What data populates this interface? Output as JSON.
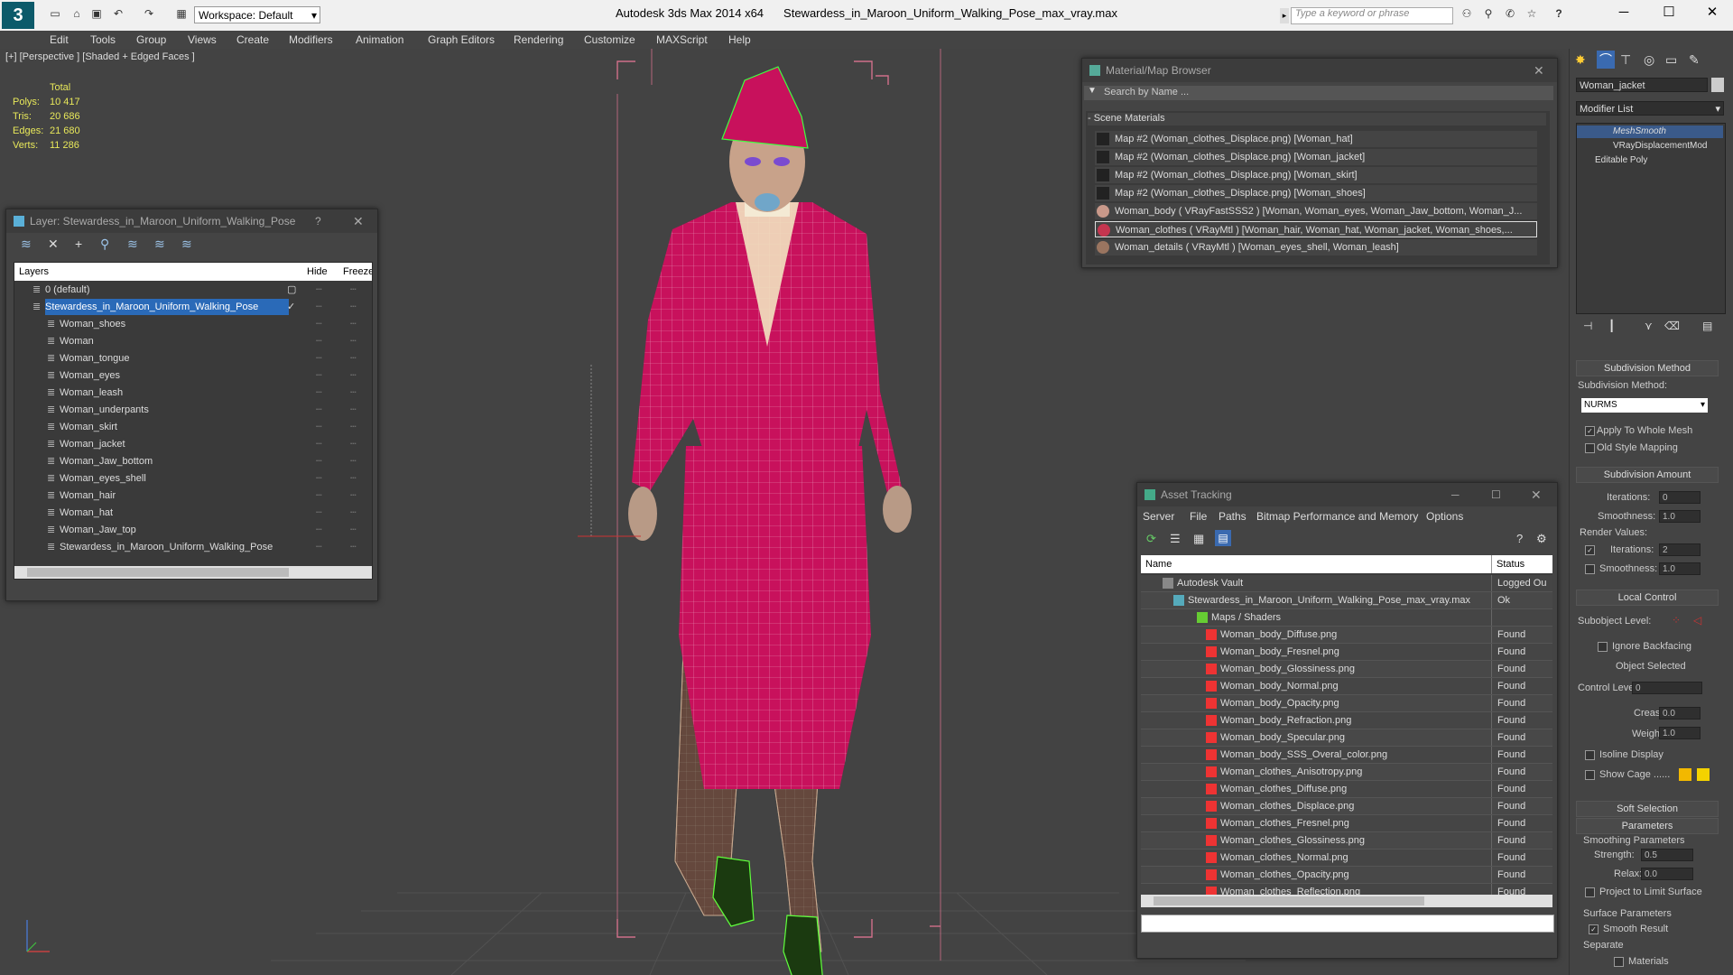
{
  "app": {
    "title": "Autodesk 3ds Max  2014 x64",
    "file": "Stewardess_in_Maroon_Uniform_Walking_Pose_max_vray.max",
    "workspace": "Workspace: Default",
    "search_placeholder": "Type a keyword or phrase"
  },
  "menu": [
    "Edit",
    "Tools",
    "Group",
    "Views",
    "Create",
    "Modifiers",
    "Animation",
    "Graph Editors",
    "Rendering",
    "Customize",
    "MAXScript",
    "Help"
  ],
  "viewport": {
    "label": "[+] [Perspective ] [Shaded + Edged Faces ]",
    "stats_header": "Total",
    "stats": [
      {
        "label": "Polys:",
        "value": "10 417"
      },
      {
        "label": "Tris:",
        "value": "20 686"
      },
      {
        "label": "Edges:",
        "value": "21 680"
      },
      {
        "label": "Verts:",
        "value": "11 286"
      }
    ]
  },
  "layer_panel": {
    "title": "Layer: Stewardess_in_Maroon_Uniform_Walking_Pose",
    "help": "?",
    "col_layers": "Layers",
    "col_hide": "Hide",
    "col_freeze": "Freeze",
    "layers": [
      {
        "name": "0 (default)",
        "level": 0
      },
      {
        "name": "Stewardess_in_Maroon_Uniform_Walking_Pose",
        "level": 0
      },
      {
        "name": "Woman_shoes",
        "level": 1
      },
      {
        "name": "Woman",
        "level": 1
      },
      {
        "name": "Woman_tongue",
        "level": 1
      },
      {
        "name": "Woman_eyes",
        "level": 1
      },
      {
        "name": "Woman_leash",
        "level": 1
      },
      {
        "name": "Woman_underpants",
        "level": 1
      },
      {
        "name": "Woman_skirt",
        "level": 1
      },
      {
        "name": "Woman_jacket",
        "level": 1
      },
      {
        "name": "Woman_Jaw_bottom",
        "level": 1
      },
      {
        "name": "Woman_eyes_shell",
        "level": 1
      },
      {
        "name": "Woman_hair",
        "level": 1
      },
      {
        "name": "Woman_hat",
        "level": 1
      },
      {
        "name": "Woman_Jaw_top",
        "level": 1
      },
      {
        "name": "Stewardess_in_Maroon_Uniform_Walking_Pose",
        "level": 1
      }
    ]
  },
  "material_browser": {
    "title": "Material/Map Browser",
    "search_placeholder": "Search by Name ...",
    "section": "- Scene Materials",
    "items": [
      "Map #2 (Woman_clothes_Displace.png)  [Woman_hat]",
      "Map #2 (Woman_clothes_Displace.png)  [Woman_jacket]",
      "Map #2 (Woman_clothes_Displace.png)  [Woman_skirt]",
      "Map #2 (Woman_clothes_Displace.png)  [Woman_shoes]",
      "Woman_body  ( VRayFastSSS2 )  [Woman, Woman_eyes, Woman_Jaw_bottom, Woman_J...",
      "Woman_clothes  ( VRayMtl )  [Woman_hair, Woman_hat, Woman_jacket, Woman_shoes,...",
      "Woman_details  ( VRayMtl )  [Woman_eyes_shell, Woman_leash]"
    ]
  },
  "asset_tracking": {
    "title": "Asset Tracking",
    "menu": [
      "Server",
      "File",
      "Paths",
      "Bitmap Performance and Memory",
      "Options"
    ],
    "col_name": "Name",
    "col_status": "Status",
    "rows": [
      {
        "name": "Autodesk Vault",
        "status": "Logged Ou",
        "indent": 0
      },
      {
        "name": "Stewardess_in_Maroon_Uniform_Walking_Pose_max_vray.max",
        "status": "Ok",
        "indent": 1
      },
      {
        "name": "Maps / Shaders",
        "status": "",
        "indent": 2
      },
      {
        "name": "Woman_body_Diffuse.png",
        "status": "Found",
        "indent": 3
      },
      {
        "name": "Woman_body_Fresnel.png",
        "status": "Found",
        "indent": 3
      },
      {
        "name": "Woman_body_Glossiness.png",
        "status": "Found",
        "indent": 3
      },
      {
        "name": "Woman_body_Normal.png",
        "status": "Found",
        "indent": 3
      },
      {
        "name": "Woman_body_Opacity.png",
        "status": "Found",
        "indent": 3
      },
      {
        "name": "Woman_body_Refraction.png",
        "status": "Found",
        "indent": 3
      },
      {
        "name": "Woman_body_Specular.png",
        "status": "Found",
        "indent": 3
      },
      {
        "name": "Woman_body_SSS_Overal_color.png",
        "status": "Found",
        "indent": 3
      },
      {
        "name": "Woman_clothes_Anisotropy.png",
        "status": "Found",
        "indent": 3
      },
      {
        "name": "Woman_clothes_Diffuse.png",
        "status": "Found",
        "indent": 3
      },
      {
        "name": "Woman_clothes_Displace.png",
        "status": "Found",
        "indent": 3
      },
      {
        "name": "Woman_clothes_Fresnel.png",
        "status": "Found",
        "indent": 3
      },
      {
        "name": "Woman_clothes_Glossiness.png",
        "status": "Found",
        "indent": 3
      },
      {
        "name": "Woman_clothes_Normal.png",
        "status": "Found",
        "indent": 3
      },
      {
        "name": "Woman_clothes_Opacity.png",
        "status": "Found",
        "indent": 3
      },
      {
        "name": "Woman_clothes_Reflection.png",
        "status": "Found",
        "indent": 3
      }
    ]
  },
  "command_panel": {
    "object_name": "Woman_jacket",
    "modifier_list": "Modifier List",
    "stack": [
      "MeshSmooth",
      "VRayDisplacementMod",
      "Editable Poly"
    ],
    "subdivision_method_header": "Subdivision Method",
    "subdivision_method_label": "Subdivision Method:",
    "subdivision_method_value": "NURMS",
    "apply_whole_mesh": "Apply To Whole Mesh",
    "old_style_mapping": "Old Style Mapping",
    "subdivision_amount_header": "Subdivision Amount",
    "iterations_label": "Iterations:",
    "iterations_value": "0",
    "smoothness_label": "Smoothness:",
    "smoothness_value": "1.0",
    "render_values_label": "Render Values:",
    "render_iterations_label": "Iterations:",
    "render_iterations_value": "2",
    "render_smoothness_label": "Smoothness:",
    "render_smoothness_value": "1.0",
    "local_control_header": "Local Control",
    "subobject_level_label": "Subobject Level:",
    "ignore_backfacing": "Ignore Backfacing",
    "object_selected": "Object Selected",
    "control_level_label": "Control Level:",
    "control_level_value": "0",
    "crease_label": "Crease:",
    "crease_value": "0.0",
    "weight_label": "Weight:",
    "weight_value": "1.0",
    "isoline_display": "Isoline Display",
    "show_cage": "Show Cage ......",
    "soft_selection_header": "Soft Selection",
    "parameters_header": "Parameters",
    "smoothing_parameters": "Smoothing Parameters",
    "strength_label": "Strength:",
    "strength_value": "0.5",
    "relax_label": "Relax:",
    "relax_value": "0.0",
    "project_limit_surface": "Project to Limit Surface",
    "surface_parameters": "Surface Parameters",
    "smooth_result": "Smooth Result",
    "separate_label": "Separate",
    "materials_label": "Materials"
  }
}
